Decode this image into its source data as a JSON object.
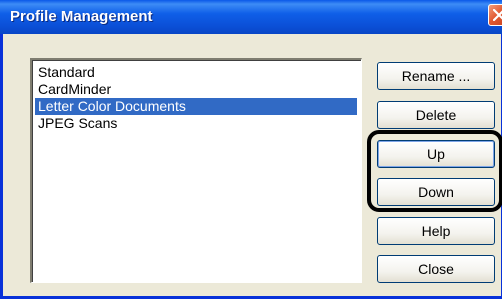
{
  "window": {
    "title": "Profile Management"
  },
  "profiles": {
    "items": [
      {
        "label": "Standard",
        "selected": false
      },
      {
        "label": "CardMinder",
        "selected": false
      },
      {
        "label": "Letter Color Documents",
        "selected": true
      },
      {
        "label": "JPEG Scans",
        "selected": false
      }
    ]
  },
  "buttons": {
    "rename": "Rename ...",
    "delete": "Delete",
    "up": "Up",
    "down": "Down",
    "help": "Help",
    "close": "Close"
  },
  "colors": {
    "titlebar": "#0a58e8",
    "selection": "#316ac5",
    "dialog_bg": "#ece9d8"
  }
}
